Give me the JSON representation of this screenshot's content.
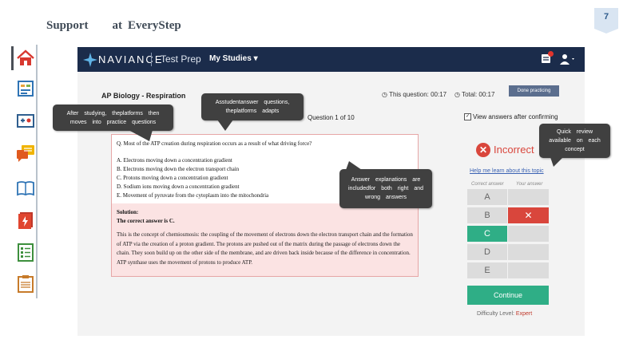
{
  "slide": {
    "title_words": [
      "Support",
      "at",
      "EveryStep"
    ],
    "page_number": "7"
  },
  "rail_icons": [
    "home-icon",
    "quiz-icon",
    "study-icon",
    "chat-icon",
    "book-icon",
    "flashcard-icon",
    "checklist-icon",
    "clipboard-icon"
  ],
  "app": {
    "brand": "NAVIANCE",
    "product": "Test Prep",
    "menu_label": "My Studies ▾",
    "course_title": "AP Biology - Respiration",
    "timer_question": "This question: 00:17",
    "timer_total": "Total: 00:17",
    "done_button": "Done practicing",
    "question_counter": "Question 1 of 10",
    "view_answers_label": "View answers after confirming",
    "view_answers_checked": true
  },
  "question": {
    "text": "Q. Most of the ATP creation during respiration occurs as a result of what driving force?",
    "choices": [
      "A.  Electrons moving down a concentration gradient",
      "B.  Electrons moving down the electron transport chain",
      "C.  Protons moving down a concentration gradient",
      "D.  Sodium ions moving down a concentration gradient",
      "E.  Movement of pyruvate from the cytoplasm into the mitochondria"
    ]
  },
  "solution": {
    "title": "Solution:",
    "correct": "The correct answer is C.",
    "body": "This is the concept of chemiosmosis: the coupling of the movement of electrons down the electron transport chain and the formation of ATP via the creation of a proton gradient. The protons are pushed out of the matrix during the passage of electrons down the chain. They soon build up on the other side of the membrane, and are driven back inside because of the difference in concentration. ATP synthase uses the movement of protons to produce ATP."
  },
  "result": {
    "status": "Incorrect",
    "learn_link": "Help me learn about this topic",
    "col_correct": "Correct answer",
    "col_yours": "Your answer",
    "options": [
      "A",
      "B",
      "C",
      "D",
      "E"
    ],
    "correct_option": "C",
    "selected_option": "B",
    "continue_label": "Continue",
    "difficulty_label": "Difficulty Level:",
    "difficulty_value": "Expert"
  },
  "callouts": {
    "studying": "After studying, theplatforms then moves into practice questions",
    "adapts": "Asstudentanswer questions, theplatforms adapts",
    "explanations": "Answer explanations are includedfor both right and wrong answers",
    "review": "Quick review available on each concept"
  },
  "colors": {
    "navbar": "#1b2c4b",
    "incorrect": "#d9463c",
    "correct": "#2fae86",
    "callout": "#404040"
  }
}
